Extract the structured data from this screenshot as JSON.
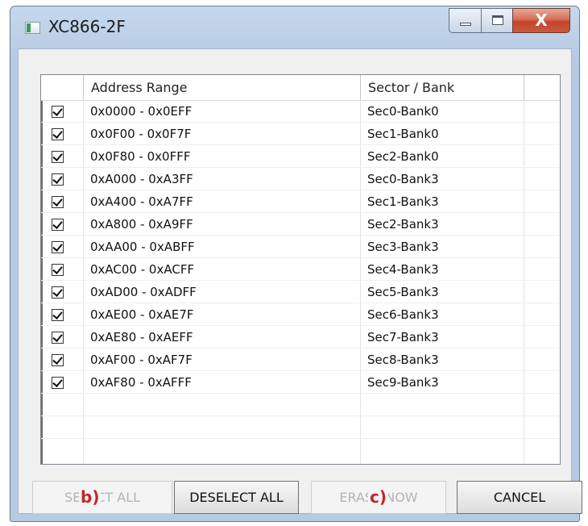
{
  "window": {
    "title": "XC866-2F",
    "controls": {
      "close_glyph": "X"
    }
  },
  "table": {
    "columns": [
      "",
      "Address Range",
      "Sector / Bank",
      ""
    ],
    "rows": [
      {
        "checked": true,
        "address": "0x0000 - 0x0EFF",
        "sector": "Sec0-Bank0"
      },
      {
        "checked": true,
        "address": "0x0F00 - 0x0F7F",
        "sector": "Sec1-Bank0"
      },
      {
        "checked": true,
        "address": "0x0F80 - 0x0FFF",
        "sector": "Sec2-Bank0"
      },
      {
        "checked": true,
        "address": "0xA000 - 0xA3FF",
        "sector": "Sec0-Bank3"
      },
      {
        "checked": true,
        "address": "0xA400 - 0xA7FF",
        "sector": "Sec1-Bank3"
      },
      {
        "checked": true,
        "address": "0xA800 - 0xA9FF",
        "sector": "Sec2-Bank3"
      },
      {
        "checked": true,
        "address": "0xAA00 - 0xABFF",
        "sector": "Sec3-Bank3"
      },
      {
        "checked": true,
        "address": "0xAC00 - 0xACFF",
        "sector": "Sec4-Bank3"
      },
      {
        "checked": true,
        "address": "0xAD00 - 0xADFF",
        "sector": "Sec5-Bank3"
      },
      {
        "checked": true,
        "address": "0xAE00 - 0xAE7F",
        "sector": "Sec6-Bank3"
      },
      {
        "checked": true,
        "address": "0xAE80 - 0xAEFF",
        "sector": "Sec7-Bank3"
      },
      {
        "checked": true,
        "address": "0xAF00 - 0xAF7F",
        "sector": "Sec8-Bank3"
      },
      {
        "checked": true,
        "address": "0xAF80 - 0xAFFF",
        "sector": "Sec9-Bank3"
      }
    ]
  },
  "buttons": {
    "select_all": {
      "label": "SELECT ALL",
      "enabled": false
    },
    "deselect_all": {
      "label": "DESELECT ALL",
      "enabled": true
    },
    "erase_now": {
      "label": "ERASE NOW",
      "enabled": false
    },
    "cancel": {
      "label": "CANCEL",
      "enabled": true
    }
  },
  "annotations": {
    "b": "b)",
    "c": "c)"
  },
  "colors": {
    "annotation": "#c0262d",
    "close_button": "#c4442a",
    "window_frame": "#bcd0e7"
  }
}
